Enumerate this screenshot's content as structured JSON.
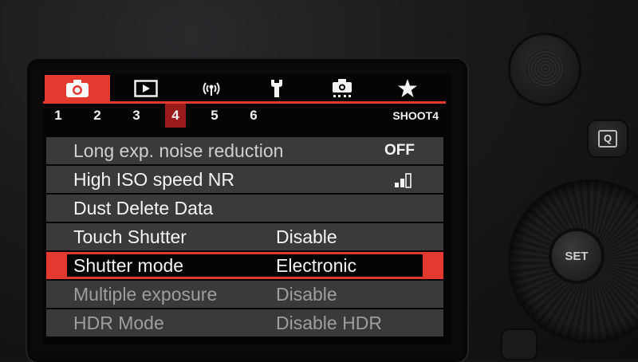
{
  "tabs": [
    {
      "name": "shooting-tab",
      "icon": "camera-icon",
      "active": true
    },
    {
      "name": "playback-tab",
      "icon": "playback-icon",
      "active": false
    },
    {
      "name": "wireless-tab",
      "icon": "wireless-icon",
      "active": false
    },
    {
      "name": "setup-tab",
      "icon": "wrench-icon",
      "active": false
    },
    {
      "name": "custom-functions-tab",
      "icon": "custom-functions-icon",
      "active": false
    },
    {
      "name": "my-menu-tab",
      "icon": "star-icon",
      "active": false
    }
  ],
  "pages": [
    "1",
    "2",
    "3",
    "4",
    "5",
    "6"
  ],
  "active_page": "4",
  "page_label": "SHOOT4",
  "menu_items": [
    {
      "label": "Long exp. noise reduction",
      "value": "OFF"
    },
    {
      "label": "High ISO speed NR",
      "value_icon": "nr-level-bars-icon"
    },
    {
      "label": "Dust Delete Data",
      "value": ""
    },
    {
      "label": "Touch Shutter",
      "value": "Disable"
    },
    {
      "label": "Shutter mode",
      "value": "Electronic"
    },
    {
      "label": "Multiple exposure",
      "value": "Disable"
    },
    {
      "label": "HDR Mode",
      "value": "Disable HDR"
    }
  ],
  "selected_item": "Shutter mode",
  "buttons": {
    "q": "Q",
    "set": "SET"
  },
  "colors": {
    "accent": "#e23a2e",
    "active_page": "#9b1b1b",
    "row": "#3a3a3a"
  }
}
